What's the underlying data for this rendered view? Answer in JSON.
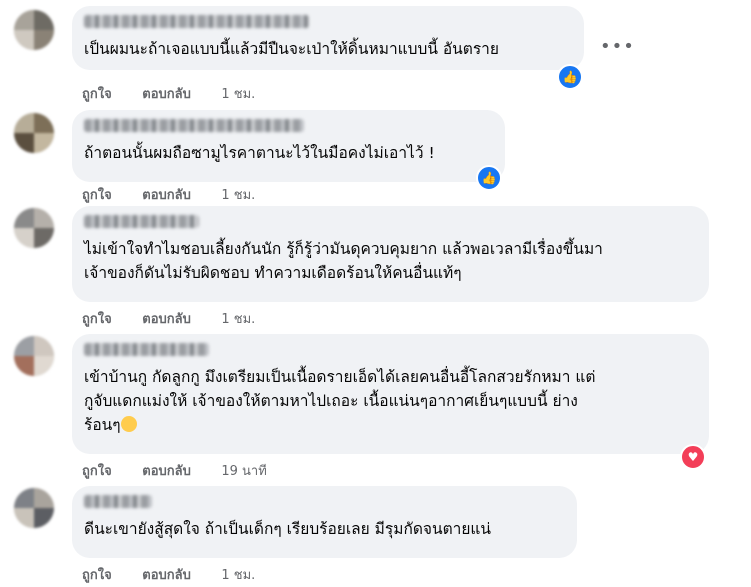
{
  "actions": {
    "like": "ถูกใจ",
    "reply": "ตอบกลับ"
  },
  "more_icon": "more-options-icon",
  "comments": [
    {
      "text": "เป็นผมนะถ้าเจอแบบนี้แล้วมีปืนจะเป่าให้ดิ้นหมาแบบนี้ อันตราย",
      "time": "1 ชม.",
      "reaction": "like"
    },
    {
      "text": "ถ้าตอนนั้นผมถือซามูไรคาตานะไว้ในมือคงไม่เอาไว้ !",
      "time": "1 ชม.",
      "reaction": "like"
    },
    {
      "text": "ไม่เข้าใจทำไมชอบเลี้ยงกันนัก รู้ก็รู้ว่ามันดุควบคุมยาก แล้วพอเวลามีเรื่องขึ้นมา\nเจ้าของก็ดันไม่รับผิดชอบ ทำความเดือดร้อนให้คนอื่นแท้ๆ",
      "time": "1 ชม.",
      "reaction": "none"
    },
    {
      "text": "เข้าบ้านกู กัดลูกกู มึงเตรียมเป็นเนื้อดรายเอ็ดได้เลยคนอื่นอี้โลกสวยรักหมา แต่\nกูจับแดกแม่งให้ เจ้าของให้ตามหาไปเถอะ เนื้อแน่นๆอากาศเย็นๆแบบนี้ ย่าง\nร้อนๆ",
      "time": "19 นาที",
      "reaction": "love"
    },
    {
      "text": "ดีนะเขายังสู้สุดใจ ถ้าเป็นเด็กๆ เรียบร้อยเลย มีรุมกัดจนตายแน่",
      "time": "1 ชม.",
      "reaction": "none"
    }
  ],
  "colors": {
    "bubble": "#f0f2f5",
    "like": "#1877f2",
    "love": "#f33e58",
    "meta": "#65676b"
  }
}
